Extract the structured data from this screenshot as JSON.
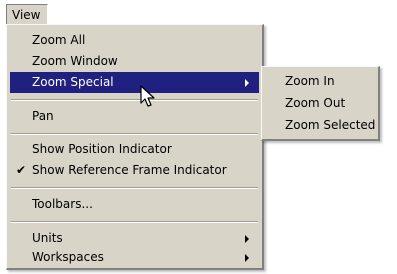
{
  "menubar": {
    "title": "View"
  },
  "menu": {
    "items": [
      {
        "label": "Zoom All"
      },
      {
        "label": "Zoom Window"
      },
      {
        "label": "Zoom Special",
        "submenu": true,
        "highlighted": true
      },
      {
        "label": "Pan"
      },
      {
        "label": "Show Position Indicator"
      },
      {
        "label": "Show Reference Frame Indicator",
        "checked": true,
        "check_mark": "✔"
      },
      {
        "label": "Toolbars..."
      },
      {
        "label": "Units",
        "submenu": true
      },
      {
        "label": "Workspaces",
        "submenu": true
      }
    ]
  },
  "submenu": {
    "items": [
      {
        "label": "Zoom In"
      },
      {
        "label": "Zoom Out"
      },
      {
        "label": "Zoom Selected"
      }
    ]
  },
  "cursor": {
    "icon": "arrow-pointer-icon"
  },
  "colors": {
    "menu_background": "#d8d4c8",
    "highlight": "#202080",
    "highlight_text": "#ffffff"
  }
}
